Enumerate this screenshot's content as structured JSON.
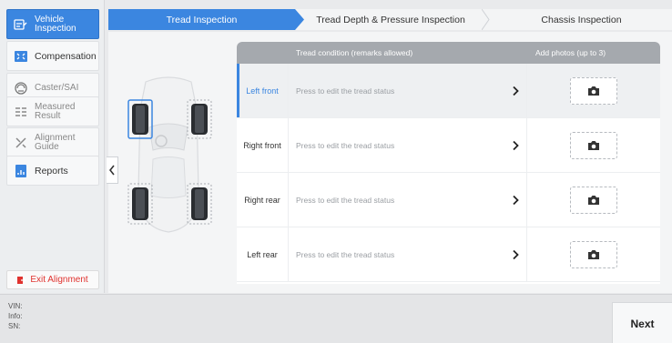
{
  "sidebar": {
    "items": [
      {
        "label1": "Vehicle",
        "label2": "Inspection",
        "icon": "vehicle-inspection-icon"
      },
      {
        "label1": "Compensation",
        "label2": "",
        "icon": "compensation-icon"
      },
      {
        "label1": "Caster/SAI",
        "label2": "",
        "icon": "caster-sai-icon"
      },
      {
        "label1": "Measured",
        "label2": "Result",
        "icon": "measured-result-icon"
      },
      {
        "label1": "Alignment",
        "label2": "Guide",
        "icon": "alignment-guide-icon"
      },
      {
        "label1": "Reports",
        "label2": "",
        "icon": "reports-icon"
      }
    ],
    "exit_label": "Exit Alignment"
  },
  "tabs": [
    {
      "label": "Tread Inspection",
      "active": true
    },
    {
      "label": "Tread Depth & Pressure Inspection",
      "active": false
    },
    {
      "label": "Chassis Inspection",
      "active": false
    }
  ],
  "table": {
    "header_condition": "Tread condition (remarks allowed)",
    "header_photos": "Add photos (up to 3)",
    "rows": [
      {
        "position": "Left front",
        "status": "Press to edit the tread status",
        "selected": true
      },
      {
        "position": "Right front",
        "status": "Press to edit the tread status",
        "selected": false
      },
      {
        "position": "Right rear",
        "status": "Press to edit the tread status",
        "selected": false
      },
      {
        "position": "Left rear",
        "status": "Press to edit the tread status",
        "selected": false
      }
    ]
  },
  "footer": {
    "vin_label": "VIN:",
    "info_label": "Info:",
    "sn_label": "SN:",
    "next_label": "Next"
  },
  "colors": {
    "accent": "#3b86e0",
    "exit": "#e0322e"
  }
}
